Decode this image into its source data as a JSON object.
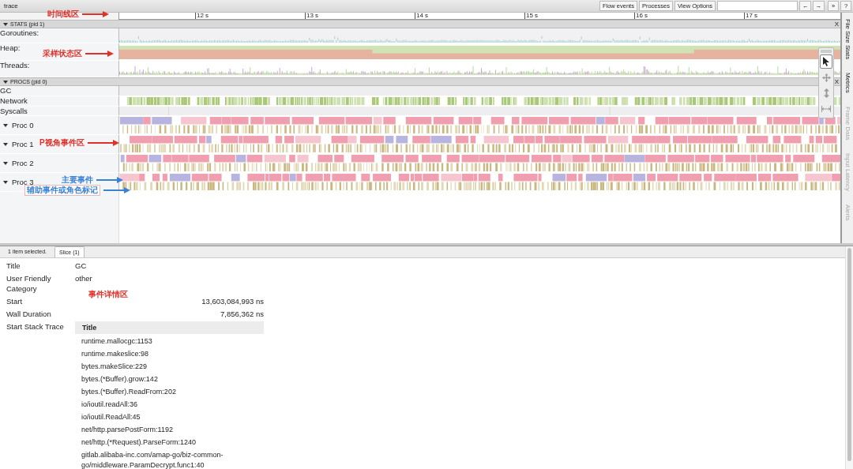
{
  "window": {
    "title": "trace"
  },
  "toolbar": {
    "buttons": [
      "Flow events",
      "Processes",
      "View Options"
    ],
    "nav_buttons": [
      "←",
      "→",
      "»",
      "?"
    ]
  },
  "ruler": {
    "ticks": [
      "12 s",
      "13 s",
      "14 s",
      "15 s",
      "16 s",
      "17 s"
    ]
  },
  "sections": [
    {
      "title": "STATS (pid 1)",
      "expanded": true,
      "close": "X",
      "tracks": [
        {
          "label": "Goroutines:",
          "kind": "counter"
        },
        {
          "label": "Heap:",
          "kind": "heap"
        },
        {
          "label": "Threads:",
          "kind": "threads"
        }
      ]
    },
    {
      "title": "PROCS (pid 0)",
      "expanded": true,
      "close": "X",
      "tracks": [
        {
          "label": "GC",
          "kind": "gc"
        },
        {
          "label": "Network",
          "kind": "network"
        },
        {
          "label": "Syscalls",
          "kind": "syscalls"
        },
        {
          "label": "Proc 0",
          "kind": "proc",
          "expanded": true
        },
        {
          "label": "Proc 1",
          "kind": "proc",
          "expanded": true
        },
        {
          "label": "Proc 2",
          "kind": "proc",
          "expanded": true
        },
        {
          "label": "Proc 3",
          "kind": "proc",
          "expanded": true
        }
      ]
    }
  ],
  "annotations": [
    {
      "text": "时间线区",
      "color": "#e0302a",
      "kind": "plain"
    },
    {
      "text": "采样状态区",
      "color": "#e0302a",
      "kind": "plain"
    },
    {
      "text": "P视角事件区",
      "color": "#e0302a",
      "kind": "plain"
    },
    {
      "text": "主要事件",
      "color": "#3b82d6",
      "kind": "plain"
    },
    {
      "text": "辅助事件或角色标记",
      "color": "#3b82d6",
      "kind": "boxed"
    },
    {
      "text": "事件详情区",
      "color": "#e0302a",
      "kind": "plain"
    }
  ],
  "tool_palette": [
    {
      "kind": "select",
      "selected": true
    },
    {
      "kind": "pan",
      "selected": false
    },
    {
      "kind": "zoom",
      "selected": false
    },
    {
      "kind": "timing",
      "selected": false
    }
  ],
  "side_tabs": [
    {
      "label": "File Size Stats",
      "disabled": false
    },
    {
      "label": "Metrics",
      "disabled": false
    },
    {
      "label": "Frame Data",
      "disabled": true
    },
    {
      "label": "Input Latency",
      "disabled": true
    },
    {
      "label": "Alerts",
      "disabled": true
    }
  ],
  "details": {
    "selection": "1 item selected.",
    "tabs": [
      {
        "label": "Slice (1)",
        "selected": true
      }
    ],
    "rows": [
      {
        "label": "Title",
        "value": "GC",
        "kind": "text"
      },
      {
        "label": "User Friendly Category",
        "value": "other",
        "kind": "text"
      },
      {
        "label": "Start",
        "value": "13,603,084,993 ns",
        "kind": "number"
      },
      {
        "label": "Wall Duration",
        "value": "7,856,362 ns",
        "kind": "number"
      }
    ],
    "stack_trace": {
      "label": "Start Stack Trace",
      "header": "Title",
      "frames": [
        "runtime.mallocgc:1153",
        "runtime.makeslice:98",
        "bytes.makeSlice:229",
        "bytes.(*Buffer).grow:142",
        "bytes.(*Buffer).ReadFrom:202",
        "io/ioutil.readAll:36",
        "io/ioutil.ReadAll:45",
        "net/http.parsePostForm:1192",
        "net/http.(*Request).ParseForm:1240",
        "gitlab.alibaba-inc.com/amap-go/biz-common-go/middleware.ParamDecrypt.func1:40"
      ]
    }
  }
}
